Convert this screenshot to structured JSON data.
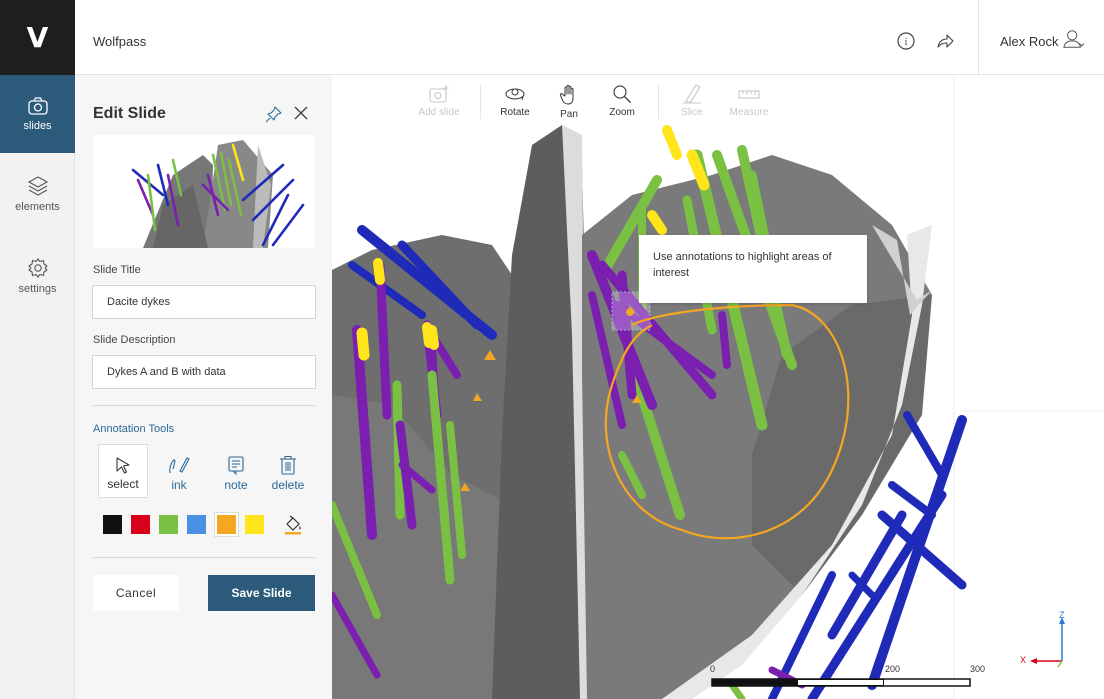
{
  "app": {
    "logo": "V",
    "project": "Wolfpass",
    "user": "Alex Rock"
  },
  "nav": [
    {
      "label": "slides",
      "icon": "camera-icon"
    },
    {
      "label": "elements",
      "icon": "layers-icon"
    },
    {
      "label": "settings",
      "icon": "gear-icon"
    }
  ],
  "panel": {
    "title": "Edit Slide",
    "slide_title_label": "Slide Title",
    "slide_title_value": "Dacite dykes",
    "slide_desc_label": "Slide Description",
    "slide_desc_value": "Dykes A and B with data",
    "tools_label": "Annotation Tools",
    "tools": [
      {
        "label": "select",
        "icon": "cursor-icon",
        "active": true
      },
      {
        "label": "ink",
        "icon": "ink-pen-icon",
        "active": false
      },
      {
        "label": "note",
        "icon": "note-icon",
        "active": false
      },
      {
        "label": "delete",
        "icon": "trash-icon",
        "active": false
      }
    ],
    "colors": [
      "#111111",
      "#d9001b",
      "#7ac143",
      "#4a90e2",
      "#f5a623",
      "#ffe51a"
    ],
    "selected_color": "#f5a623",
    "cancel_label": "Cancel",
    "save_label": "Save Slide"
  },
  "toolbar": [
    {
      "label": "Add slide",
      "icon": "add-slide-icon",
      "enabled": false
    },
    {
      "label": "Rotate",
      "icon": "rotate-icon",
      "enabled": true
    },
    {
      "label": "Pan",
      "icon": "hand-icon",
      "enabled": true
    },
    {
      "label": "Zoom",
      "icon": "magnifier-icon",
      "enabled": true
    },
    {
      "label": "Slice",
      "icon": "slice-icon",
      "enabled": false
    },
    {
      "label": "Measure",
      "icon": "ruler-icon",
      "enabled": false
    }
  ],
  "annotation_note": "Use annotations to highlight areas of interest",
  "scale_bar": {
    "labels": [
      "0",
      "200",
      "300"
    ]
  },
  "axes": {
    "z": "Z",
    "x": "X"
  }
}
